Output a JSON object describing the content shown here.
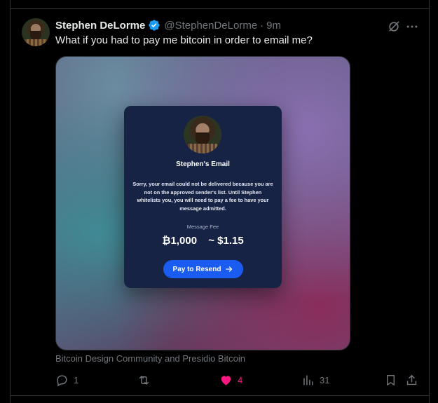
{
  "author": {
    "name": "Stephen DeLorme",
    "handle": "@StephenDeLorme",
    "separator": "·",
    "time": "9m"
  },
  "tweet": {
    "text": "What if you had to pay me bitcoin in order to email me?"
  },
  "media_card": {
    "title": "Stephen's Email",
    "body": "Sorry, your email could not be delivered because you are not on the approved sender's list. Until Stephen whitelists you, you will need to pay a fee to have your message admitted.",
    "fee_label": "Message Fee",
    "btc_amount": "₿1,000",
    "usd_amount": "~ $1.15",
    "button_label": "Pay to Resend",
    "button_color": "#1a5cf0"
  },
  "caption": "Bitcoin Design Community and Presidio Bitcoin",
  "actions": {
    "replies": "1",
    "reposts": "",
    "likes": "4",
    "views": "31",
    "liked": true,
    "like_color": "#f91880"
  },
  "icons": [
    "verified-badge-icon",
    "grok-icon",
    "more-icon",
    "reply-icon",
    "repost-icon",
    "heart-icon",
    "views-icon",
    "bookmark-icon",
    "share-icon"
  ],
  "colors": {
    "background": "#000000",
    "text": "#e7e9ea",
    "muted": "#71767b",
    "verified": "#1d9bf0",
    "border": "#2f3336"
  }
}
